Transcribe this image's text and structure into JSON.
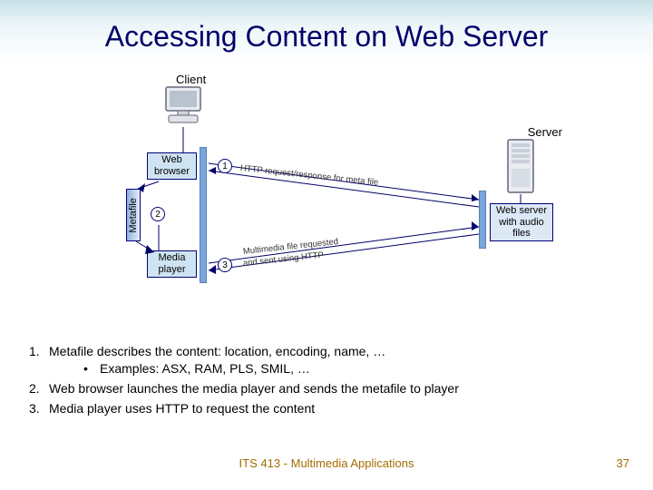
{
  "slide": {
    "title": "Accessing Content on Web Server",
    "footer_course": "ITS 413 - Multimedia Applications",
    "page_number": "37"
  },
  "diagram": {
    "client_label": "Client",
    "server_label": "Server",
    "boxes": {
      "web_browser": "Web\nbrowser",
      "media_player": "Media\nplayer",
      "metafile": "Metafile",
      "server_box": "Web server\nwith audio\nfiles"
    },
    "steps": {
      "s1": "1",
      "s2": "2",
      "s3": "3"
    },
    "annotations": {
      "http_meta": "HTTP request/response for meta file",
      "mm_req_a": "Multimedia file requested",
      "mm_req_b": "and sent using HTTP"
    }
  },
  "bullets": {
    "b1_num": "1.",
    "b1": "Metafile describes the content: location, encoding, name, …",
    "b1_sub": "Examples: ASX, RAM, PLS, SMIL, …",
    "b2_num": "2.",
    "b2": "Web browser launches the media player and sends the metafile to player",
    "b3_num": "3.",
    "b3": "Media player uses HTTP to request the content"
  }
}
